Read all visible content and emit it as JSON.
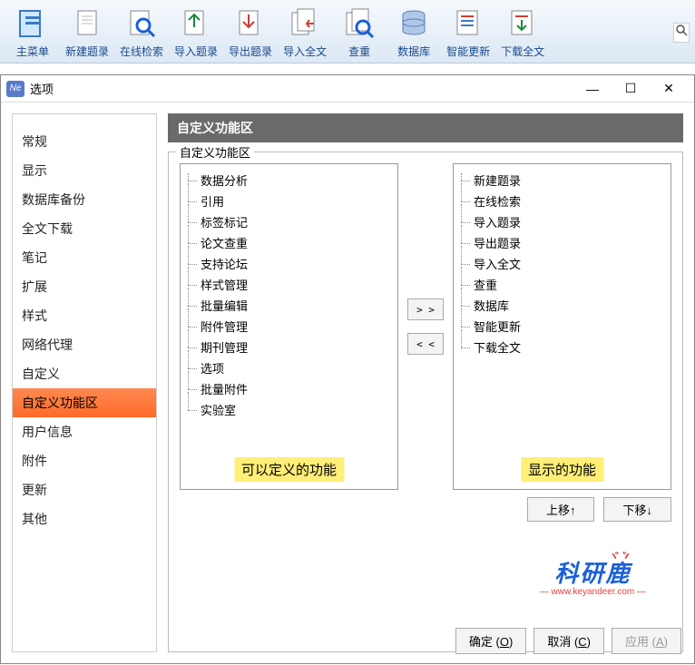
{
  "toolbar": {
    "items": [
      {
        "label": "主菜单",
        "icon": "menu"
      },
      {
        "label": "新建题录",
        "icon": "new"
      },
      {
        "label": "在线检索",
        "icon": "search-online"
      },
      {
        "label": "导入题录",
        "icon": "import"
      },
      {
        "label": "导出题录",
        "icon": "export"
      },
      {
        "label": "导入全文",
        "icon": "import-full"
      },
      {
        "label": "查重",
        "icon": "dedup"
      },
      {
        "label": "数据库",
        "icon": "database"
      },
      {
        "label": "智能更新",
        "icon": "update"
      },
      {
        "label": "下载全文",
        "icon": "download"
      }
    ],
    "search_icon": "search"
  },
  "dialog": {
    "title": "选项",
    "app_icon_text": "Ne"
  },
  "sidebar": {
    "items": [
      {
        "label": "常规"
      },
      {
        "label": "显示"
      },
      {
        "label": "数据库备份"
      },
      {
        "label": "全文下载"
      },
      {
        "label": "笔记"
      },
      {
        "label": "扩展"
      },
      {
        "label": "样式"
      },
      {
        "label": "网络代理"
      },
      {
        "label": "自定义"
      },
      {
        "label": "自定义功能区",
        "selected": true
      },
      {
        "label": "用户信息"
      },
      {
        "label": "附件"
      },
      {
        "label": "更新"
      },
      {
        "label": "其他"
      }
    ]
  },
  "panel": {
    "header": "自定义功能区",
    "fieldset_legend": "自定义功能区",
    "available": {
      "items": [
        "数据分析",
        "引用",
        "标签标记",
        "论文查重",
        "支持论坛",
        "样式管理",
        "批量编辑",
        "附件管理",
        "期刊管理",
        "选项",
        "批量附件",
        "实验室"
      ],
      "hint": "可以定义的功能"
    },
    "shown": {
      "items": [
        "新建题录",
        "在线检索",
        "导入题录",
        "导出题录",
        "导入全文",
        "查重",
        "数据库",
        "智能更新",
        "下载全文"
      ],
      "hint": "显示的功能"
    },
    "move_right": "> >",
    "move_left": "< <",
    "move_up": "上移↑",
    "move_down": "下移↓"
  },
  "watermark": {
    "text": "科研鹿",
    "url": "— www.keyandeer.com —"
  },
  "footer": {
    "ok": "确定",
    "ok_key": "O",
    "cancel": "取消",
    "cancel_key": "C",
    "apply": "应用",
    "apply_key": "A"
  }
}
